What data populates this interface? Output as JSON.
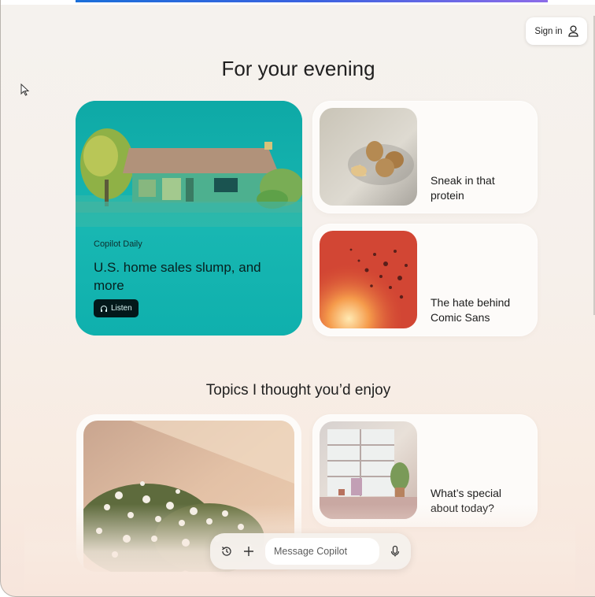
{
  "header": {
    "sign_in_label": "Sign in",
    "icons": [
      "person-icon"
    ]
  },
  "sections": {
    "evening_title": "For your evening",
    "topics_title": "Topics I thought you’d enjoy"
  },
  "hero": {
    "kicker": "Copilot Daily",
    "title": "U.S. home sales slump, and more",
    "listen_label": "Listen",
    "listen_icon": "headphones-icon",
    "bg_color": "#0fb0ad"
  },
  "cards": [
    {
      "title": "Sneak in that protein",
      "image": "nuts-image"
    },
    {
      "title": "The hate behind Comic Sans",
      "image": "sparks-image"
    },
    {
      "title": "What’s special about today?",
      "image": "window-room-image"
    }
  ],
  "big_topic_card": {
    "image": "flowering-shrub-image"
  },
  "composer": {
    "placeholder": "Message Copilot",
    "icons": [
      "history-icon",
      "plus-icon",
      "microphone-icon"
    ]
  },
  "colors": {
    "accent_bar": "#1b6fd9",
    "background": "#f6f0eb"
  }
}
